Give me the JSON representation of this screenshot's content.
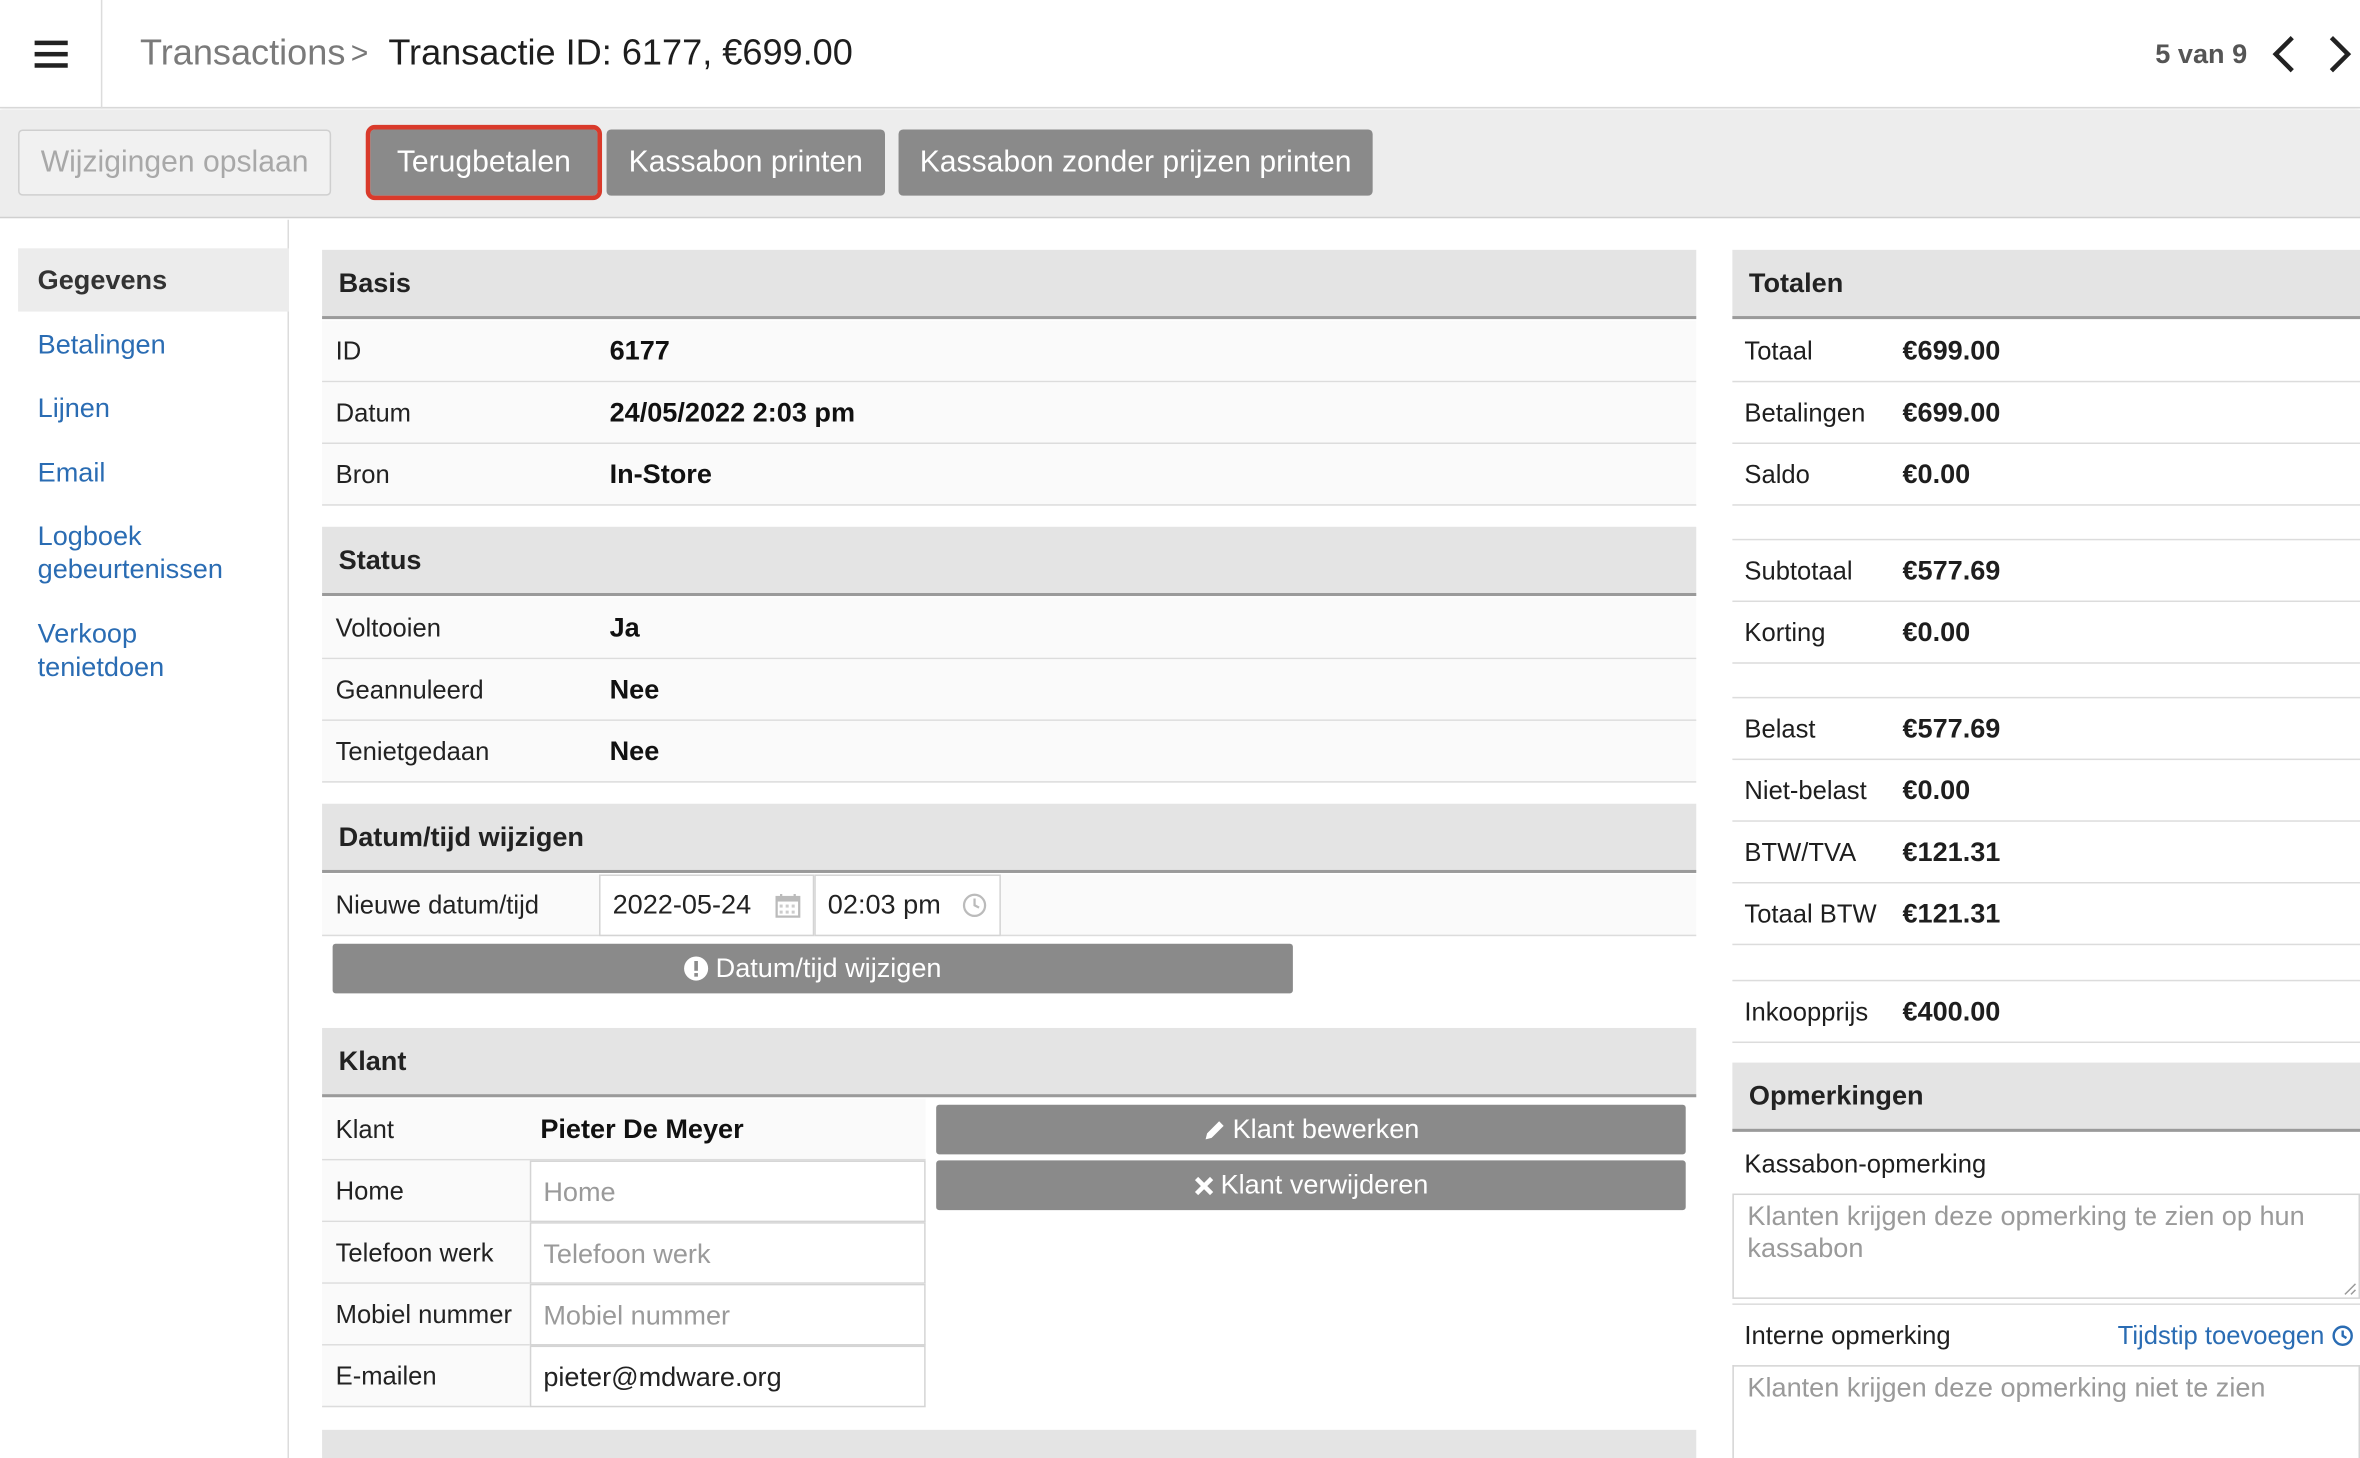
{
  "header": {
    "breadcrumb_root": "Transactions",
    "breadcrumb_sep": ">",
    "title": "Transactie  ID: 6177, €699.00",
    "pager": "5 van 9"
  },
  "toolbar": {
    "save": "Wijzigingen opslaan",
    "refund": "Terugbetalen",
    "print": "Kassabon printen",
    "print_no_prices": "Kassabon zonder prijzen printen"
  },
  "sidebar": {
    "active": "Gegevens",
    "links": [
      "Betalingen",
      "Lijnen",
      "Email",
      "Logboek gebeurtenissen",
      "Verkoop tenietdoen"
    ]
  },
  "basis": {
    "title": "Basis",
    "rows": [
      {
        "label": "ID",
        "value": "6177"
      },
      {
        "label": "Datum",
        "value": "24/05/2022 2:03 pm"
      },
      {
        "label": "Bron",
        "value": "In-Store"
      }
    ]
  },
  "status": {
    "title": "Status",
    "rows": [
      {
        "label": "Voltooien",
        "value": "Ja"
      },
      {
        "label": "Geannuleerd",
        "value": "Nee"
      },
      {
        "label": "Tenietgedaan",
        "value": "Nee"
      }
    ]
  },
  "datetime": {
    "title": "Datum/tijd wijzigen",
    "label": "Nieuwe datum/tijd",
    "date": "2022-05-24",
    "time": "02:03 pm",
    "button": "Datum/tijd wijzigen"
  },
  "klant": {
    "title": "Klant",
    "name_label": "Klant",
    "name": "Pieter De Meyer",
    "fields": [
      {
        "label": "Home",
        "placeholder": "Home",
        "value": ""
      },
      {
        "label": "Telefoon werk",
        "placeholder": "Telefoon werk",
        "value": ""
      },
      {
        "label": "Mobiel nummer",
        "placeholder": "Mobiel nummer",
        "value": ""
      },
      {
        "label": "E-mailen",
        "placeholder": "",
        "value": "pieter@mdware.org"
      }
    ],
    "edit_button": "Klant bewerken",
    "remove_button": "Klant verwijderen"
  },
  "totalen": {
    "title": "Totalen",
    "group1": [
      {
        "label": "Totaal",
        "value": "€699.00"
      },
      {
        "label": "Betalingen",
        "value": "€699.00"
      },
      {
        "label": "Saldo",
        "value": "€0.00"
      }
    ],
    "group2": [
      {
        "label": "Subtotaal",
        "value": "€577.69"
      },
      {
        "label": "Korting",
        "value": "€0.00"
      }
    ],
    "group3": [
      {
        "label": "Belast",
        "value": "€577.69"
      },
      {
        "label": "Niet-belast",
        "value": "€0.00"
      },
      {
        "label": "BTW/TVA",
        "value": "€121.31"
      },
      {
        "label": "Totaal BTW",
        "value": "€121.31"
      }
    ],
    "group4": [
      {
        "label": "Inkoopprijs",
        "value": "€400.00"
      }
    ]
  },
  "opmerkingen": {
    "title": "Opmerkingen",
    "receipt_label": "Kassabon-opmerking",
    "receipt_placeholder": "Klanten krijgen deze opmerking te zien op hun kassabon",
    "internal_label": "Interne opmerking",
    "add_time": "Tijdstip toevoegen",
    "internal_placeholder": "Klanten krijgen deze opmerking niet te zien"
  },
  "colors": {
    "link": "#2a6cb3",
    "button_gray": "#8a8a8a",
    "highlight": "#d93a2b"
  }
}
